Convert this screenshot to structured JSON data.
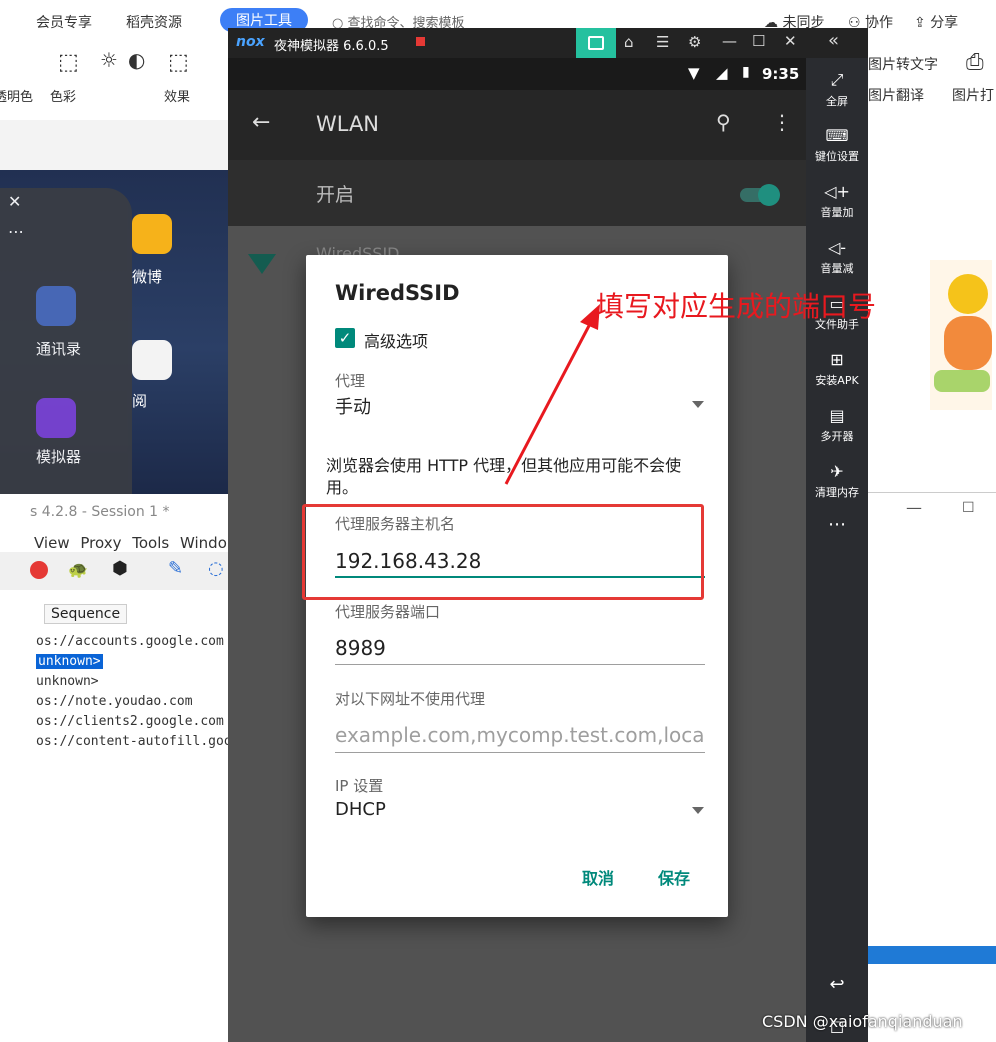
{
  "wps": {
    "tabs": [
      "会员专享",
      "稻壳资源",
      "图片工具"
    ],
    "search_label": "查找命令、搜索模板",
    "right_items": [
      "未同步",
      "协作",
      "分享"
    ],
    "tools": [
      "透明色",
      "色彩",
      "效果"
    ],
    "right_tools": [
      "图片转文字",
      "图片翻译",
      "图片打"
    ]
  },
  "left_phone": {
    "apps": [
      "微博",
      "通讯录",
      "阅",
      "模拟器"
    ]
  },
  "charles": {
    "title": "s 4.2.8 - Session 1 *",
    "menu": [
      "View",
      "Proxy",
      "Tools",
      "Windo"
    ],
    "column_header": "Sequence",
    "rows": [
      "os://accounts.google.com",
      "unknown>",
      "unknown>",
      "os://note.youdao.com",
      "os://clients2.google.com",
      "os://content-autofill.goo"
    ]
  },
  "nox": {
    "title": "夜神模拟器 6.6.0.5",
    "logo": "nox",
    "sidebar": [
      "全屏",
      "键位设置",
      "音量加",
      "音量减",
      "文件助手",
      "安装APK",
      "多开器",
      "清理内存"
    ],
    "time": "9:35"
  },
  "android": {
    "appbar_title": "WLAN",
    "switch_label": "开启",
    "network_partial": "WiredSSID",
    "dialog": {
      "title": "WiredSSID",
      "advanced_label": "高级选项",
      "proxy_label": "代理",
      "proxy_value": "手动",
      "proxy_note": "浏览器会使用 HTTP 代理，但其他应用可能不会使用。",
      "host_label": "代理服务器主机名",
      "host_value": "192.168.43.28",
      "port_label": "代理服务器端口",
      "port_value": "8989",
      "bypass_label": "对以下网址不使用代理",
      "bypass_placeholder": "example.com,mycomp.test.com,localh",
      "ip_label": "IP 设置",
      "ip_value": "DHCP",
      "cancel": "取消",
      "save": "保存"
    }
  },
  "annotation": "填写对应生成的端口号",
  "watermark": "CSDN @xaiofanqianduan",
  "colors": {
    "accent": "#00897b",
    "annotation": "#e8191f",
    "wps_blue": "#3d7ff6"
  }
}
